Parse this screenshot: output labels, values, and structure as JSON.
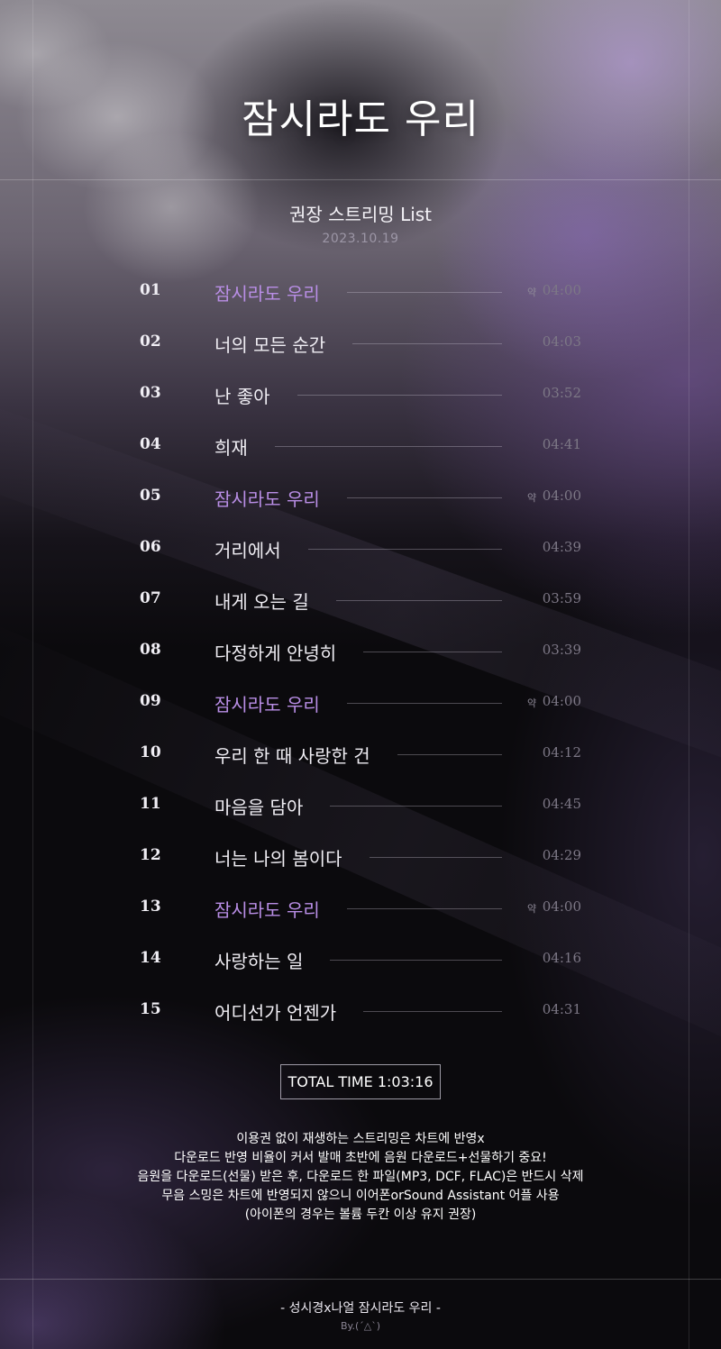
{
  "header": {
    "title": "잠시라도 우리",
    "subtitle": "권장 스트리밍 List",
    "date": "2023.10.19"
  },
  "tracks": [
    {
      "num": "01",
      "name": "잠시라도 우리",
      "approx": "약",
      "time": "04:00",
      "highlight": true
    },
    {
      "num": "02",
      "name": "너의 모든 순간",
      "approx": "",
      "time": "04:03",
      "highlight": false
    },
    {
      "num": "03",
      "name": "난 좋아",
      "approx": "",
      "time": "03:52",
      "highlight": false
    },
    {
      "num": "04",
      "name": "희재",
      "approx": "",
      "time": "04:41",
      "highlight": false
    },
    {
      "num": "05",
      "name": "잠시라도 우리",
      "approx": "약",
      "time": "04:00",
      "highlight": true
    },
    {
      "num": "06",
      "name": "거리에서",
      "approx": "",
      "time": "04:39",
      "highlight": false
    },
    {
      "num": "07",
      "name": "내게 오는 길",
      "approx": "",
      "time": "03:59",
      "highlight": false
    },
    {
      "num": "08",
      "name": "다정하게 안녕히",
      "approx": "",
      "time": "03:39",
      "highlight": false
    },
    {
      "num": "09",
      "name": "잠시라도 우리",
      "approx": "약",
      "time": "04:00",
      "highlight": true
    },
    {
      "num": "10",
      "name": "우리 한 때 사랑한 건",
      "approx": "",
      "time": "04:12",
      "highlight": false
    },
    {
      "num": "11",
      "name": "마음을 담아",
      "approx": "",
      "time": "04:45",
      "highlight": false
    },
    {
      "num": "12",
      "name": "너는 나의 봄이다",
      "approx": "",
      "time": "04:29",
      "highlight": false
    },
    {
      "num": "13",
      "name": "잠시라도 우리",
      "approx": "약",
      "time": "04:00",
      "highlight": true
    },
    {
      "num": "14",
      "name": "사랑하는 일",
      "approx": "",
      "time": "04:16",
      "highlight": false
    },
    {
      "num": "15",
      "name": "어디선가 언젠가",
      "approx": "",
      "time": "04:31",
      "highlight": false
    }
  ],
  "total_time": "TOTAL TIME 1:03:16",
  "notes": [
    "이용권 없이 재생하는 스트리밍은 차트에 반영x",
    "다운로드 반영 비율이 커서 발매 초반에 음원 다운로드+선물하기 중요!",
    "음원을 다운로드(선물) 받은 후, 다운로드 한 파일(MP3, DCF, FLAC)은 반드시 삭제",
    "무음 스밍은 차트에 반영되지 않으니 이어폰orSound Assistant 어플 사용",
    "(아이폰의 경우는 볼륨 두칸 이상 유지 권장)"
  ],
  "footer": {
    "credit": "- 성시경x나얼 잠시라도 우리 -",
    "by": "By.(´△`)"
  },
  "colors": {
    "highlight": "#b98ee6",
    "background": "#0b0a0d"
  }
}
